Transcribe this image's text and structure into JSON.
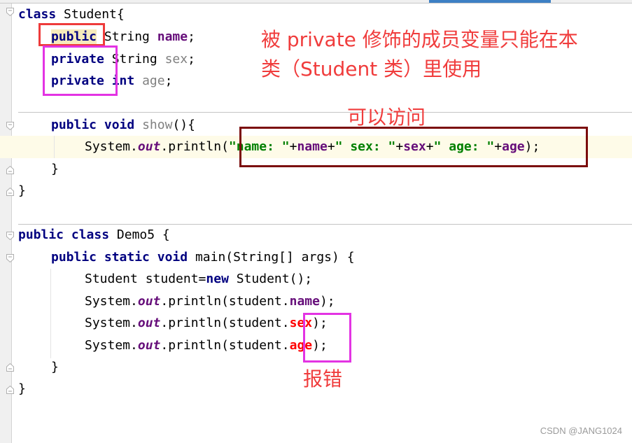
{
  "editor": {
    "student_class": {
      "header": {
        "kw_class": "class",
        "name": "Student",
        "brace": "{"
      },
      "field_name": {
        "modifier": "public",
        "type": "String",
        "name": "name",
        "semi": ";"
      },
      "field_sex": {
        "modifier": "private",
        "type": "String",
        "name": "sex",
        "semi": ";"
      },
      "field_age": {
        "modifier": "private",
        "type": "int",
        "name": "age",
        "semi": ";"
      },
      "show_method": {
        "kw_public": "public",
        "kw_void": "void",
        "name": "show",
        "parens": "(){"
      },
      "println": {
        "prefix": "System.",
        "out": "out",
        "call": ".println(",
        "s1": "\"name: \"",
        "p1": "+",
        "v1": "name",
        "p2": "+",
        "s2": "\" sex: \"",
        "p3": "+",
        "v2": "sex",
        "p4": "+",
        "s3": "\" age: \"",
        "p5": "+",
        "v3": "age",
        "end": ");"
      },
      "method_close": "}",
      "class_close": "}"
    },
    "demo_class": {
      "header": {
        "kw_public": "public",
        "kw_class": "class",
        "name": "Demo5",
        "brace": " {"
      },
      "main": {
        "kw_public": "public",
        "kw_static": "static",
        "kw_void": "void",
        "rest": "main(String[] args) {"
      },
      "line_new": {
        "pre": "Student student=",
        "kw_new": "new",
        "post": " Student();"
      },
      "line_name": {
        "prefix": "System.",
        "out": "out",
        "call": ".println(student.",
        "field": "name",
        "end": ");"
      },
      "line_sex": {
        "prefix": "System.",
        "out": "out",
        "call": ".println(student.",
        "field": "sex",
        "end": ");"
      },
      "line_age": {
        "prefix": "System.",
        "out": "out",
        "call": ".println(student.",
        "field": "age",
        "end": ");"
      },
      "method_close": "}",
      "class_close": "}"
    }
  },
  "annotations": {
    "private_note_line1": "被 private 修饰的成员变量只能在本",
    "private_note_line2": "类（Student 类）里使用",
    "accessible_note": "可以访问",
    "error_note": "报错"
  },
  "colors": {
    "annotation_text": "#f03c3c",
    "public_box": "#ee3b3b",
    "private_box": "#e333e3",
    "access_box": "#7b0c0c",
    "keyword": "#000080",
    "field": "#660e7a",
    "string": "#008000",
    "error": "#ff0000",
    "tab_indicator": "#3d80c4"
  },
  "watermark": "CSDN @JANG1024"
}
